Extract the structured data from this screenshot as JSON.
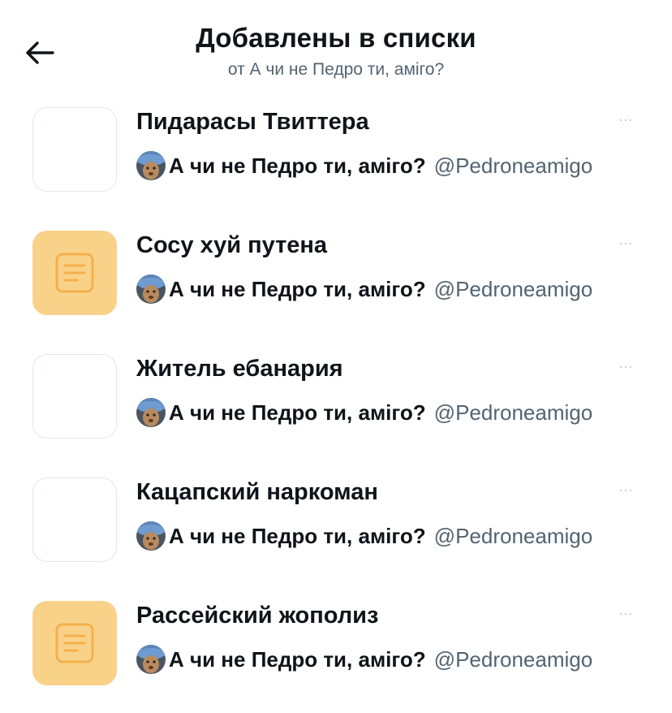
{
  "header": {
    "title": "Добавлены в списки",
    "subtitle": "от А чи не Педро ти, аміго?"
  },
  "icons": {
    "back": "arrow-left-icon",
    "list_placeholder": "list-document-icon",
    "more": "more-dots-icon"
  },
  "colors": {
    "placeholder_bg": "#f9d28a",
    "placeholder_icon": "#f4b04b",
    "secondary_text": "#536471"
  },
  "lists": [
    {
      "name": "Пидарасы Твиттера",
      "thumb": "blank",
      "owner": {
        "name": "А чи не Педро ти, аміго?",
        "handle": "@Pedroneamigo"
      }
    },
    {
      "name": "Сосу хуй путена",
      "thumb": "placeholder",
      "owner": {
        "name": "А чи не Педро ти, аміго?",
        "handle": "@Pedroneamigo"
      }
    },
    {
      "name": "Житель ебанария",
      "thumb": "blank",
      "owner": {
        "name": "А чи не Педро ти, аміго?",
        "handle": "@Pedroneamigo"
      }
    },
    {
      "name": "Кацапский наркоман",
      "thumb": "blank",
      "owner": {
        "name": "А чи не Педро ти, аміго?",
        "handle": "@Pedroneamigo"
      }
    },
    {
      "name": "Рассейский жополиз",
      "thumb": "placeholder",
      "owner": {
        "name": "А чи не Педро ти, аміго?",
        "handle": "@Pedroneamigo"
      }
    }
  ]
}
